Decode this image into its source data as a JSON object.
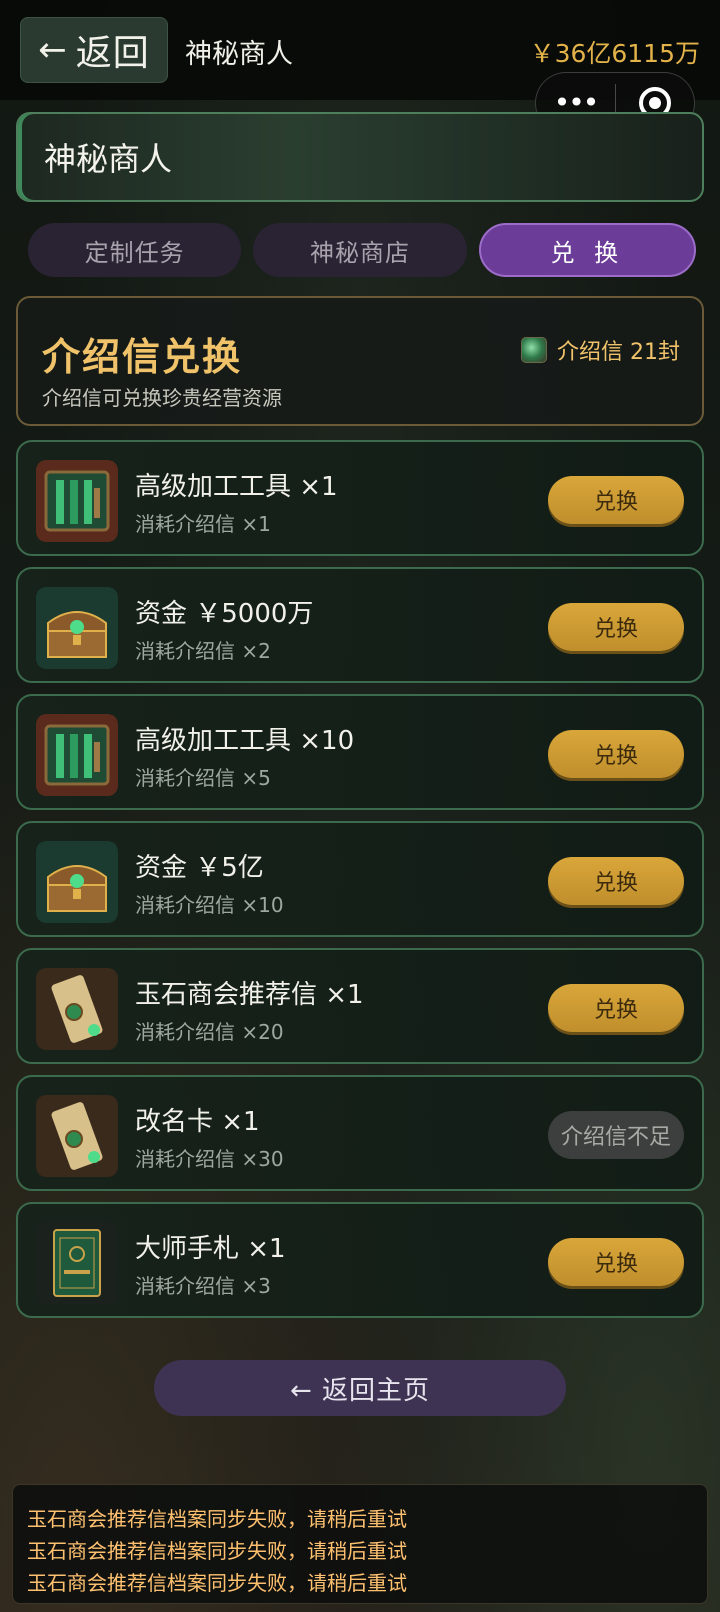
{
  "header": {
    "back_arrow": "←",
    "back_label": "返回",
    "page_name": "神秘商人",
    "money": "￥36亿6115万"
  },
  "banner": {
    "title": "神秘商人"
  },
  "tabs": [
    {
      "label": "定制任务",
      "active": false
    },
    {
      "label": "神秘商店",
      "active": false
    },
    {
      "label": "兑 换",
      "active": true
    }
  ],
  "exchange": {
    "title": "介绍信兑换",
    "subtitle": "介绍信可兑换珍贵经营资源",
    "count": "介绍信 21封",
    "count_icon": "letter-gem-icon"
  },
  "items": [
    {
      "name": "高级加工工具 ×1",
      "cost": "消耗介绍信 ×1",
      "button": "兑换",
      "enabled": true,
      "icon": "tools-icon"
    },
    {
      "name": "资金 ￥5000万",
      "cost": "消耗介绍信 ×2",
      "button": "兑换",
      "enabled": true,
      "icon": "treasure-chest-icon"
    },
    {
      "name": "高级加工工具 ×10",
      "cost": "消耗介绍信 ×5",
      "button": "兑换",
      "enabled": true,
      "icon": "tools-icon"
    },
    {
      "name": "资金 ￥5亿",
      "cost": "消耗介绍信 ×10",
      "button": "兑换",
      "enabled": true,
      "icon": "treasure-chest-icon"
    },
    {
      "name": "玉石商会推荐信 ×1",
      "cost": "消耗介绍信 ×20",
      "button": "兑换",
      "enabled": true,
      "icon": "scroll-icon"
    },
    {
      "name": "改名卡 ×1",
      "cost": "消耗介绍信 ×30",
      "button": "介绍信不足",
      "enabled": false,
      "icon": "scroll-icon"
    },
    {
      "name": "大师手札 ×1",
      "cost": "消耗介绍信 ×3",
      "button": "兑换",
      "enabled": true,
      "icon": "book-icon"
    }
  ],
  "home_button": "← 返回主页",
  "log": [
    "玉石商会推荐信档案同步失败，请稍后重试",
    "玉石商会推荐信档案同步失败，请稍后重试",
    "玉石商会推荐信档案同步失败，请稍后重试"
  ],
  "colors": {
    "accent_gold": "#e3b34a",
    "tab_active": "#6c3d98",
    "button_gold": "#d9a63a",
    "row_border": "#3b6a4c"
  }
}
